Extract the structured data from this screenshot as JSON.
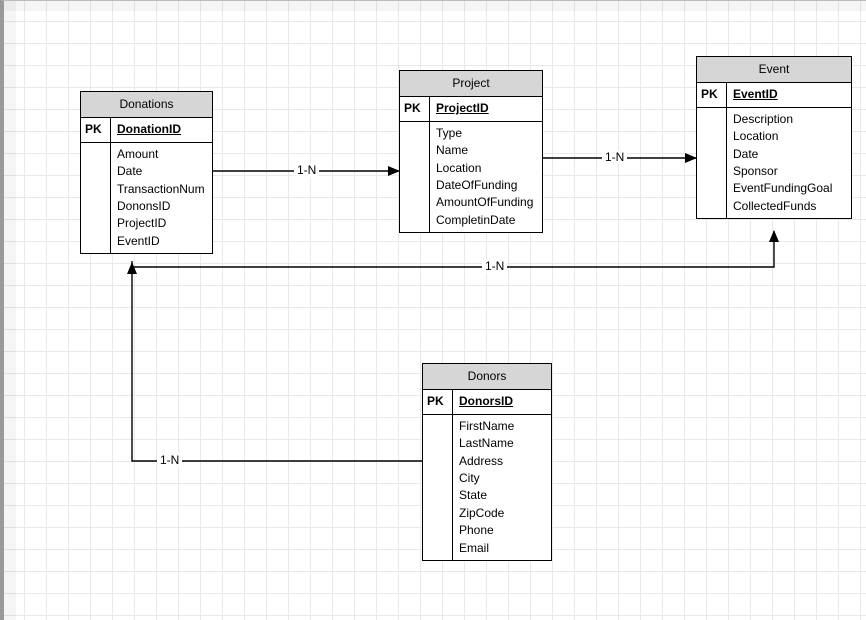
{
  "entities": {
    "donations": {
      "title": "Donations",
      "pk_label": "PK",
      "pk_field": "DonationID",
      "fields": [
        "Amount",
        "Date",
        "TransactionNum",
        "DononsID",
        "ProjectID",
        "EventID"
      ]
    },
    "project": {
      "title": "Project",
      "pk_label": "PK",
      "pk_field": "ProjectID",
      "fields": [
        "Type",
        "Name",
        "Location",
        "DateOfFunding",
        "AmountOfFunding",
        "CompletinDate"
      ]
    },
    "event": {
      "title": "Event",
      "pk_label": "PK",
      "pk_field": "EventID",
      "fields": [
        "Description",
        "Location",
        "Date",
        "Sponsor",
        "EventFundingGoal",
        "CollectedFunds"
      ]
    },
    "donors": {
      "title": "Donors",
      "pk_label": "PK",
      "pk_field": "DonorsID",
      "fields": [
        "FirstName",
        "LastName",
        "Address",
        "City",
        "State",
        "ZipCode",
        "Phone",
        "Email"
      ]
    }
  },
  "relationships": {
    "donations_project": "1-N",
    "donations_event": "1-N",
    "donors_donations": "1-N",
    "project_event": "1-N"
  }
}
